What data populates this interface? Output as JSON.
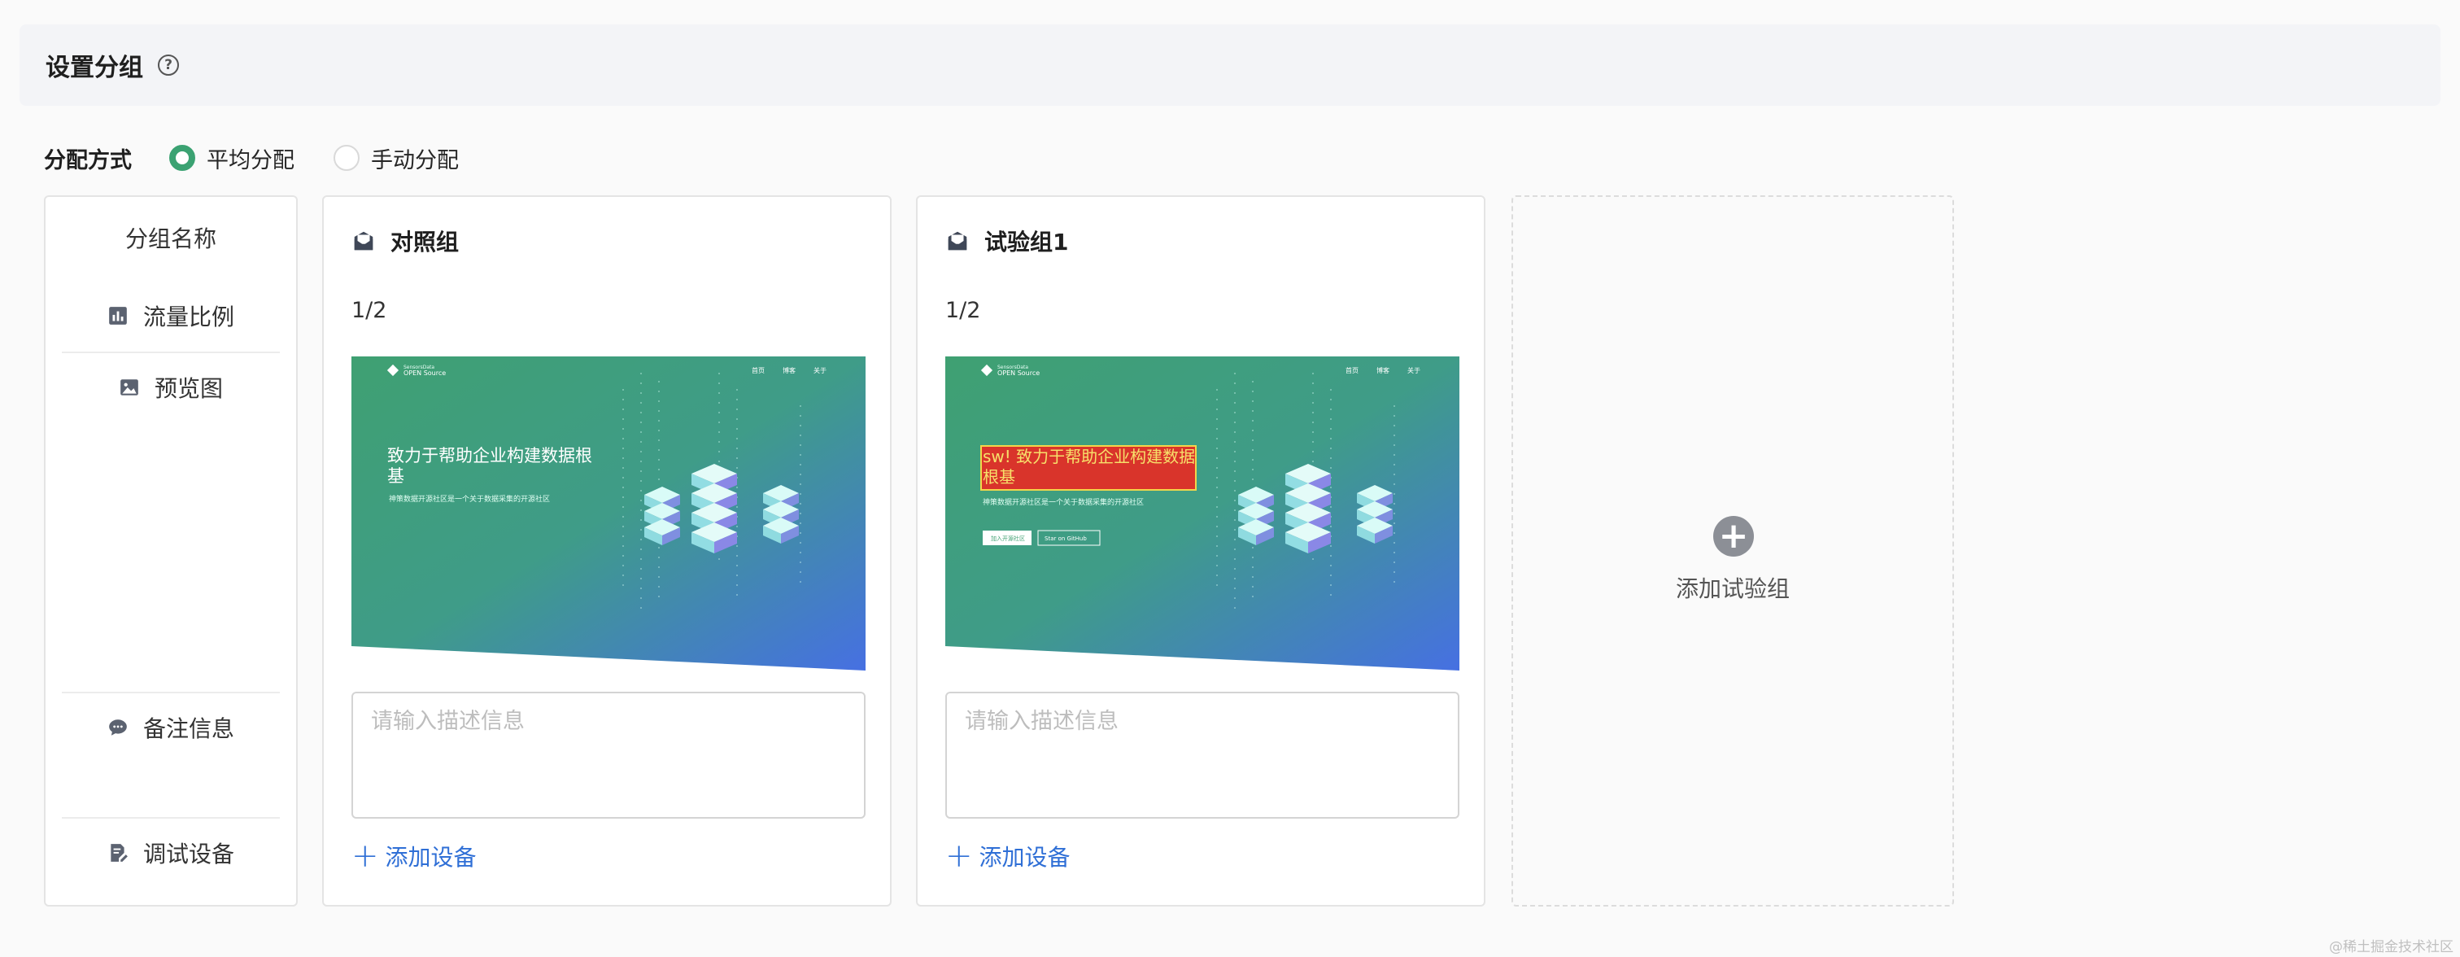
{
  "header": {
    "title": "设置分组"
  },
  "mode": {
    "label": "分配方式",
    "options": [
      {
        "label": "平均分配",
        "checked": true
      },
      {
        "label": "手动分配",
        "checked": false
      }
    ]
  },
  "labels": {
    "title": "分组名称",
    "traffic": "流量比例",
    "preview": "预览图",
    "notes": "备注信息",
    "devices": "调试设备"
  },
  "groups": [
    {
      "name": "对照组",
      "ratio": "1/2",
      "description_placeholder": "请输入描述信息",
      "add_device": "添加设备",
      "preview": {
        "logo": "OPEN Source",
        "nav": [
          "首页",
          "博客",
          "关于"
        ],
        "headline": "致力于帮助企业构建数据根基",
        "subline": "神策数据开源社区是一个关于数据采集的开源社区"
      }
    },
    {
      "name": "试验组1",
      "ratio": "1/2",
      "description_placeholder": "请输入描述信息",
      "add_device": "添加设备",
      "preview": {
        "logo": "OPEN Source",
        "nav": [
          "首页",
          "博客",
          "关于"
        ],
        "headline": "sw! 致力于帮助企业构建数据根基",
        "subline": "神策数据开源社区是一个关于数据采集的开源社区",
        "buttons": [
          "加入开源社区",
          "Star on GitHub"
        ]
      }
    }
  ],
  "add_group": {
    "label": "添加试验组"
  },
  "watermark": "@稀土掘金技术社区",
  "colors": {
    "accent_green": "#3ba272",
    "link_blue": "#2f6fd6",
    "banner_green": "#3fa072",
    "banner_blue": "#4670e2",
    "highlight_red": "#d9342b"
  }
}
